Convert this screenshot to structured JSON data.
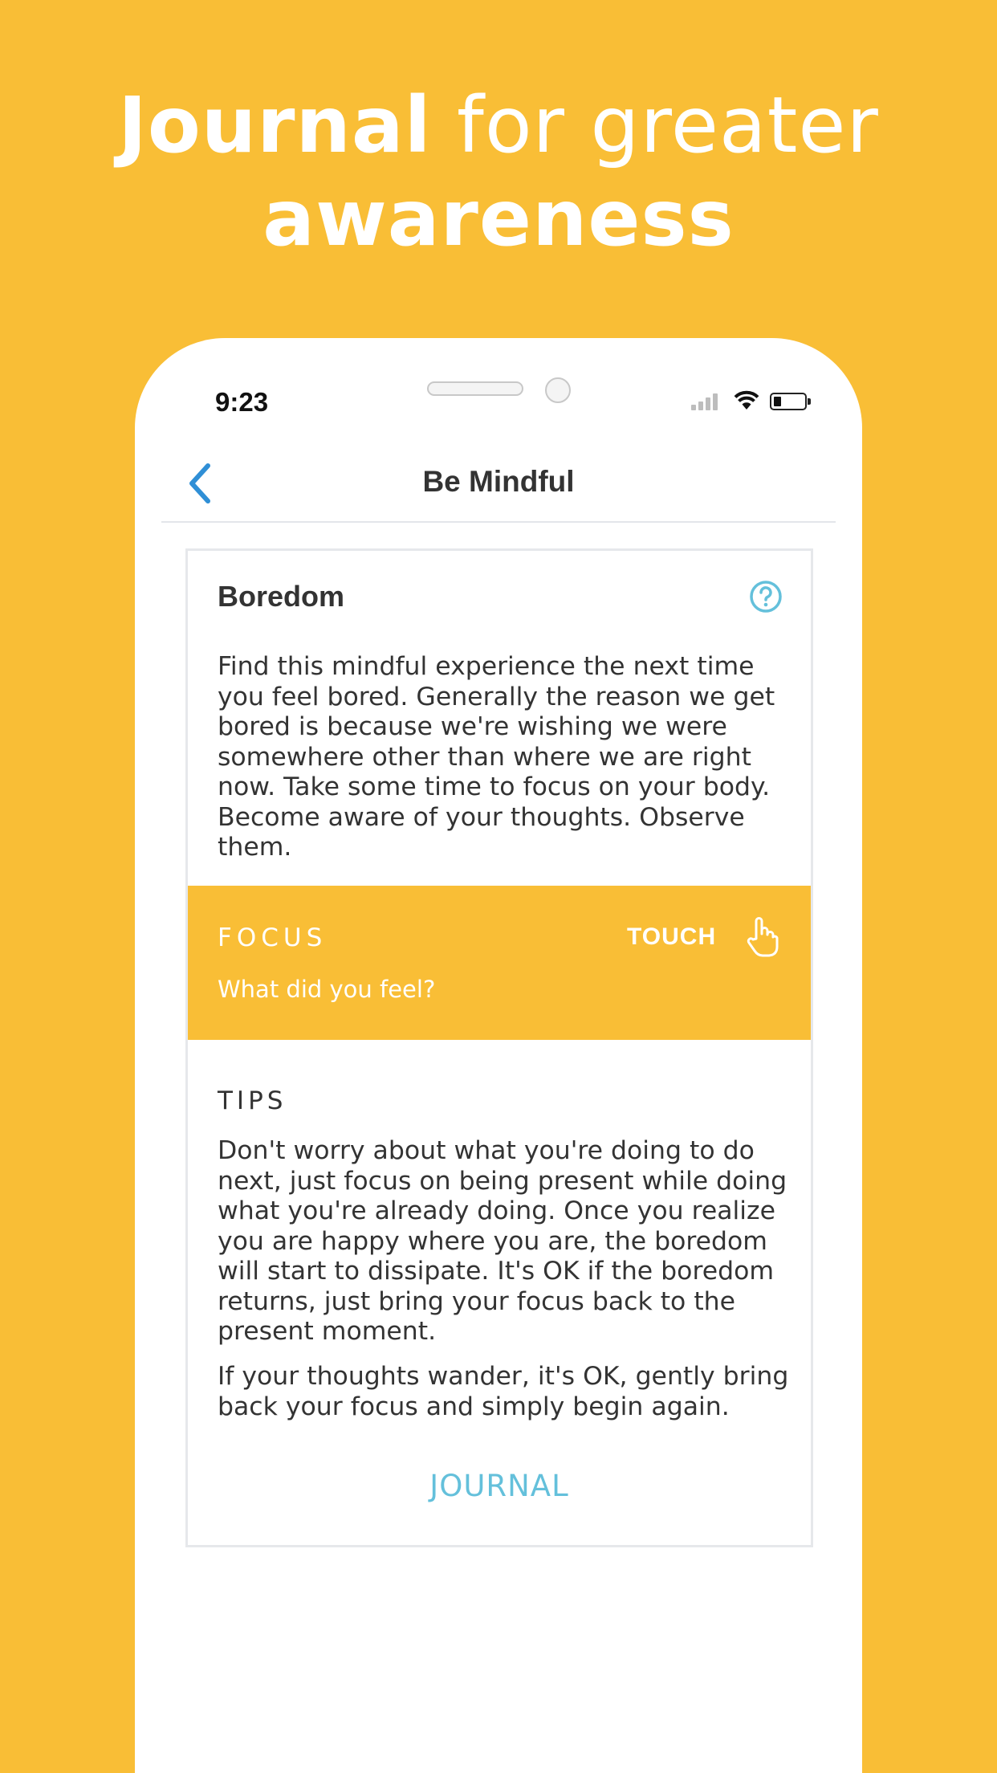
{
  "headline": {
    "line1_bold": "Journal",
    "line1_light": "for greater",
    "line2": "awareness"
  },
  "status_bar": {
    "time": "9:23",
    "icons": [
      "signal-icon",
      "wifi-icon",
      "battery-icon"
    ]
  },
  "nav": {
    "back_icon": "chevron-left-icon",
    "title": "Be Mindful"
  },
  "card": {
    "title": "Boredom",
    "help_icon": "question-circle-icon",
    "description": "Find this mindful experience the next time you feel bored. Generally the reason we get bored is because we're wishing we were somewhere other than where we are right now. Take some time to focus on your body. Become aware of your thoughts. Observe them.",
    "focus": {
      "label": "FOCUS",
      "question": "What did you feel?",
      "touch_label": "TOUCH",
      "touch_icon": "pointing-hand-icon"
    },
    "tips": {
      "label": "TIPS",
      "paragraph1": "Don't worry about what you're doing to do next, just focus on being present while doing what you're already doing. Once you realize you are happy where you are, the boredom will start to dissipate. It's OK if the boredom returns, just bring your focus back to the present moment.",
      "paragraph2": "If your thoughts wander, it's OK, gently bring back your focus and simply begin again."
    },
    "journal_label": "JOURNAL"
  },
  "colors": {
    "background": "#F9BE36",
    "accent_blue": "#2F8FD6",
    "journal_blue": "#64C0DB",
    "text": "#333333"
  }
}
